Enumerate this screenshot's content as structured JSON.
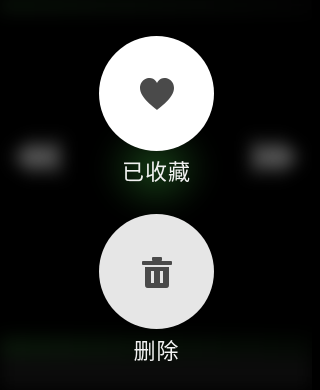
{
  "actions": {
    "favorite": {
      "label": "已收藏",
      "icon": "heart-icon",
      "circle_color": "#ffffff",
      "icon_color": "#4a4a4a"
    },
    "delete": {
      "label": "删除",
      "icon": "trash-icon",
      "circle_color": "#e6e6e6",
      "icon_color": "#4a4a4a"
    }
  },
  "background": {
    "accent_color": "#2e7d32",
    "icons": [
      "previous-track-icon",
      "play-icon",
      "next-track-icon"
    ]
  }
}
